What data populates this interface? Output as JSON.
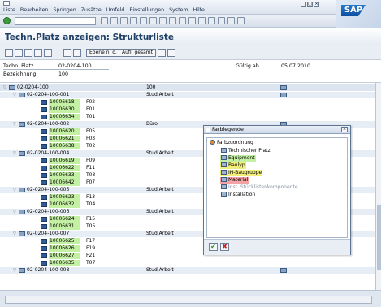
{
  "menu": [
    "Liste",
    "Bearbeiten",
    "Springen",
    "Zusätze",
    "Umfeld",
    "Einstellungen",
    "System",
    "Hilfe"
  ],
  "window_buttons": [
    "_",
    "□",
    "×"
  ],
  "brand": "SAP",
  "title": "Techn.Platz anzeigen: Strukturliste",
  "app_toolbar": {
    "btn_level": "Ebene n. o.",
    "btn_expand": "Aufl. gesamt"
  },
  "header": {
    "techn_platz_label": "Techn. Platz",
    "techn_platz_value": "02-0204-100",
    "bezeichnung_label": "Bezeichnung",
    "bezeichnung_value": "100",
    "gueltig_label": "Gültig ab",
    "gueltig_value": "05.07.2010"
  },
  "tree": [
    {
      "type": "fl",
      "level": 0,
      "label": "02-0204-100",
      "desc": "100",
      "extra": ""
    },
    {
      "type": "fl",
      "level": 1,
      "label": "02-0204-100-001",
      "desc": "",
      "extra": "Stud.Arbeit"
    },
    {
      "type": "eq",
      "code": "10006618",
      "pos": "F02"
    },
    {
      "type": "eq",
      "code": "10006630",
      "pos": "F01"
    },
    {
      "type": "eq",
      "code": "10006634",
      "pos": "T01"
    },
    {
      "type": "fl",
      "level": 1,
      "label": "02-0204-100-002",
      "desc": "",
      "extra": "Büro"
    },
    {
      "type": "eq",
      "code": "10006620",
      "pos": "F05"
    },
    {
      "type": "eq",
      "code": "10006621",
      "pos": "F03"
    },
    {
      "type": "eq",
      "code": "10006638",
      "pos": "T02"
    },
    {
      "type": "fl",
      "level": 1,
      "label": "02-0204-100-004",
      "desc": "",
      "extra": "Stud.Arbeit"
    },
    {
      "type": "eq",
      "code": "10006619",
      "pos": "F09"
    },
    {
      "type": "eq",
      "code": "10006622",
      "pos": "F11"
    },
    {
      "type": "eq",
      "code": "10006633",
      "pos": "T03"
    },
    {
      "type": "eq",
      "code": "10006642",
      "pos": "F07"
    },
    {
      "type": "fl",
      "level": 1,
      "label": "02-0204-100-005",
      "desc": "",
      "extra": "Stud.Arbeit"
    },
    {
      "type": "eq",
      "code": "10006623",
      "pos": "F13"
    },
    {
      "type": "eq",
      "code": "10006632",
      "pos": "T04"
    },
    {
      "type": "fl",
      "level": 1,
      "label": "02-0204-100-006",
      "desc": "",
      "extra": "Stud.Arbeit"
    },
    {
      "type": "eq",
      "code": "10006624",
      "pos": "F15"
    },
    {
      "type": "eq",
      "code": "10006631",
      "pos": "T05"
    },
    {
      "type": "fl",
      "level": 1,
      "label": "02-0204-100-007",
      "desc": "",
      "extra": "Stud.Arbeit"
    },
    {
      "type": "eq",
      "code": "10006625",
      "pos": "F17"
    },
    {
      "type": "eq",
      "code": "10006626",
      "pos": "F19"
    },
    {
      "type": "eq",
      "code": "10006627",
      "pos": "F21"
    },
    {
      "type": "eq",
      "code": "10006635",
      "pos": "T07"
    },
    {
      "type": "fl",
      "level": 1,
      "label": "02-0204-100-008",
      "desc": "",
      "extra": "Stud.Arbeit"
    }
  ],
  "popup": {
    "title": "Farblegende",
    "root": "Farbzuordnung",
    "items": [
      {
        "label": "Technischer Platz",
        "bg": ""
      },
      {
        "label": "Equipment",
        "bg": "#c4f0a4"
      },
      {
        "label": "Baulyp",
        "bg": "#f2ee7a"
      },
      {
        "label": "IH-Baugruppe",
        "bg": "#f2ee7a"
      },
      {
        "label": "Material",
        "bg": "#f3a3a3"
      },
      {
        "label": "Inst. Stücklistenkomponente",
        "bg": ""
      },
      {
        "label": "Installation",
        "bg": ""
      }
    ],
    "ok": "✔",
    "cancel": "✖"
  },
  "colors": {
    "equipment": "#c4f0a4",
    "accent": "#1f3f66",
    "check": "#2f8a2f",
    "cancel": "#c82020"
  }
}
